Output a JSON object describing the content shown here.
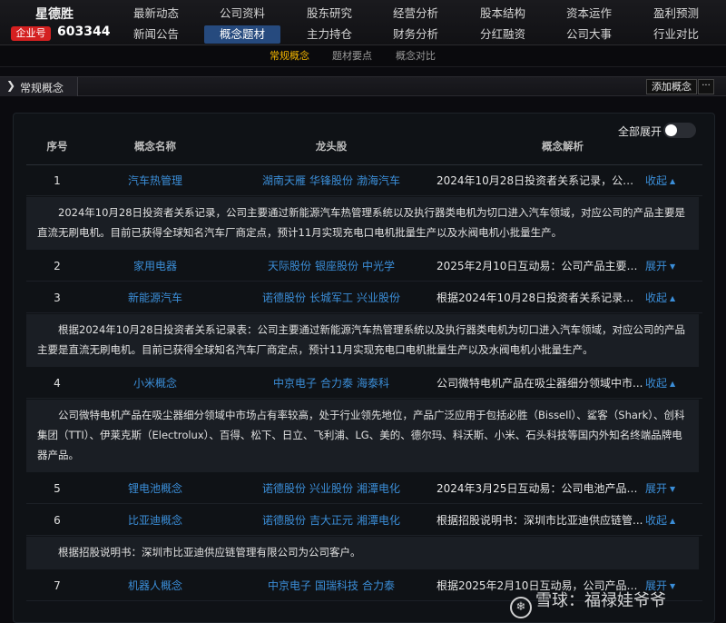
{
  "stock": {
    "name": "星德胜",
    "type_badge": "企业号",
    "code": "603344"
  },
  "nav": {
    "items": [
      {
        "label": "最新动态"
      },
      {
        "label": "公司资料"
      },
      {
        "label": "股东研究"
      },
      {
        "label": "经营分析"
      },
      {
        "label": "股本结构"
      },
      {
        "label": "资本运作"
      },
      {
        "label": "盈利预测"
      },
      {
        "label": "新闻公告"
      },
      {
        "label": "概念题材"
      },
      {
        "label": "主力持仓"
      },
      {
        "label": "财务分析"
      },
      {
        "label": "分红融资"
      },
      {
        "label": "公司大事"
      },
      {
        "label": "行业对比"
      }
    ],
    "active": "概念题材"
  },
  "subnav": {
    "items": [
      {
        "label": "常规概念"
      },
      {
        "label": "题材要点"
      },
      {
        "label": "概念对比"
      }
    ],
    "active": "常规概念"
  },
  "section": {
    "title": "常规概念",
    "add_button": "添加概念",
    "more_button": "···"
  },
  "table": {
    "expand_all_label": "全部展开",
    "columns": [
      "序号",
      "概念名称",
      "龙头股",
      "概念解析"
    ],
    "rows": [
      {
        "index": "1",
        "name": "汽车热管理",
        "leaders": [
          "湖南天雁",
          "华锋股份",
          "渤海汽车"
        ],
        "summary": "2024年10月28日投资者关系记录，公司...",
        "toggle": "收起",
        "detail": "2024年10月28日投资者关系记录，公司主要通过新能源汽车热管理系统以及执行器类电机为切口进入汽车领域，对应公司的产品主要是直流无刷电机。目前已获得全球知名汽车厂商定点，预计11月实现充电口电机批量生产以及水阀电机小批量生产。"
      },
      {
        "index": "2",
        "name": "家用电器",
        "leaders": [
          "天际股份",
          "银座股份",
          "中光学"
        ],
        "summary": "2025年2月10日互动易：公司产品主要应...",
        "toggle": "展开"
      },
      {
        "index": "3",
        "name": "新能源汽车",
        "leaders": [
          "诺德股份",
          "长城军工",
          "兴业股份"
        ],
        "summary": "根据2024年10月28日投资者关系记录表...",
        "toggle": "收起",
        "detail": "根据2024年10月28日投资者关系记录表：公司主要通过新能源汽车热管理系统以及执行器类电机为切口进入汽车领域，对应公司的产品主要是直流无刷电机。目前已获得全球知名汽车厂商定点，预计11月实现充电口电机批量生产以及水阀电机小批量生产。"
      },
      {
        "index": "4",
        "name": "小米概念",
        "leaders": [
          "中京电子",
          "合力泰",
          "海泰科"
        ],
        "summary": "公司微特电机产品在吸尘器细分领域中市...",
        "toggle": "收起",
        "detail": "公司微特电机产品在吸尘器细分领域中市场占有率较高，处于行业领先地位，产品广泛应用于包括必胜（Bissell）、鲨客（Shark）、创科集团（TTI）、伊莱克斯（Electrolux）、百得、松下、日立、飞利浦、LG、美的、德尔玛、科沃斯、小米、石头科技等国内外知名终端品牌电器产品。"
      },
      {
        "index": "5",
        "name": "锂电池概念",
        "leaders": [
          "诺德股份",
          "兴业股份",
          "湘潭电化"
        ],
        "summary": "2024年3月25日互动易：公司电池产品为...",
        "toggle": "展开"
      },
      {
        "index": "6",
        "name": "比亚迪概念",
        "leaders": [
          "诺德股份",
          "吉大正元",
          "湘潭电化"
        ],
        "summary": "根据招股说明书：深圳市比亚迪供应链管...",
        "toggle": "收起",
        "detail": "根据招股说明书：深圳市比亚迪供应链管理有限公司为公司客户。"
      },
      {
        "index": "7",
        "name": "机器人概念",
        "leaders": [
          "中京电子",
          "国瑞科技",
          "合力泰"
        ],
        "summary": "根据2025年2月10日互动易，公司产品主...",
        "toggle": "展开"
      }
    ]
  },
  "watermark": {
    "text": "雪球：福禄娃爷爷"
  },
  "colors": {
    "link": "#3b8ed8",
    "active_tab": "#264a7e",
    "subnav_active": "#f0b400",
    "badge": "#d42020"
  }
}
